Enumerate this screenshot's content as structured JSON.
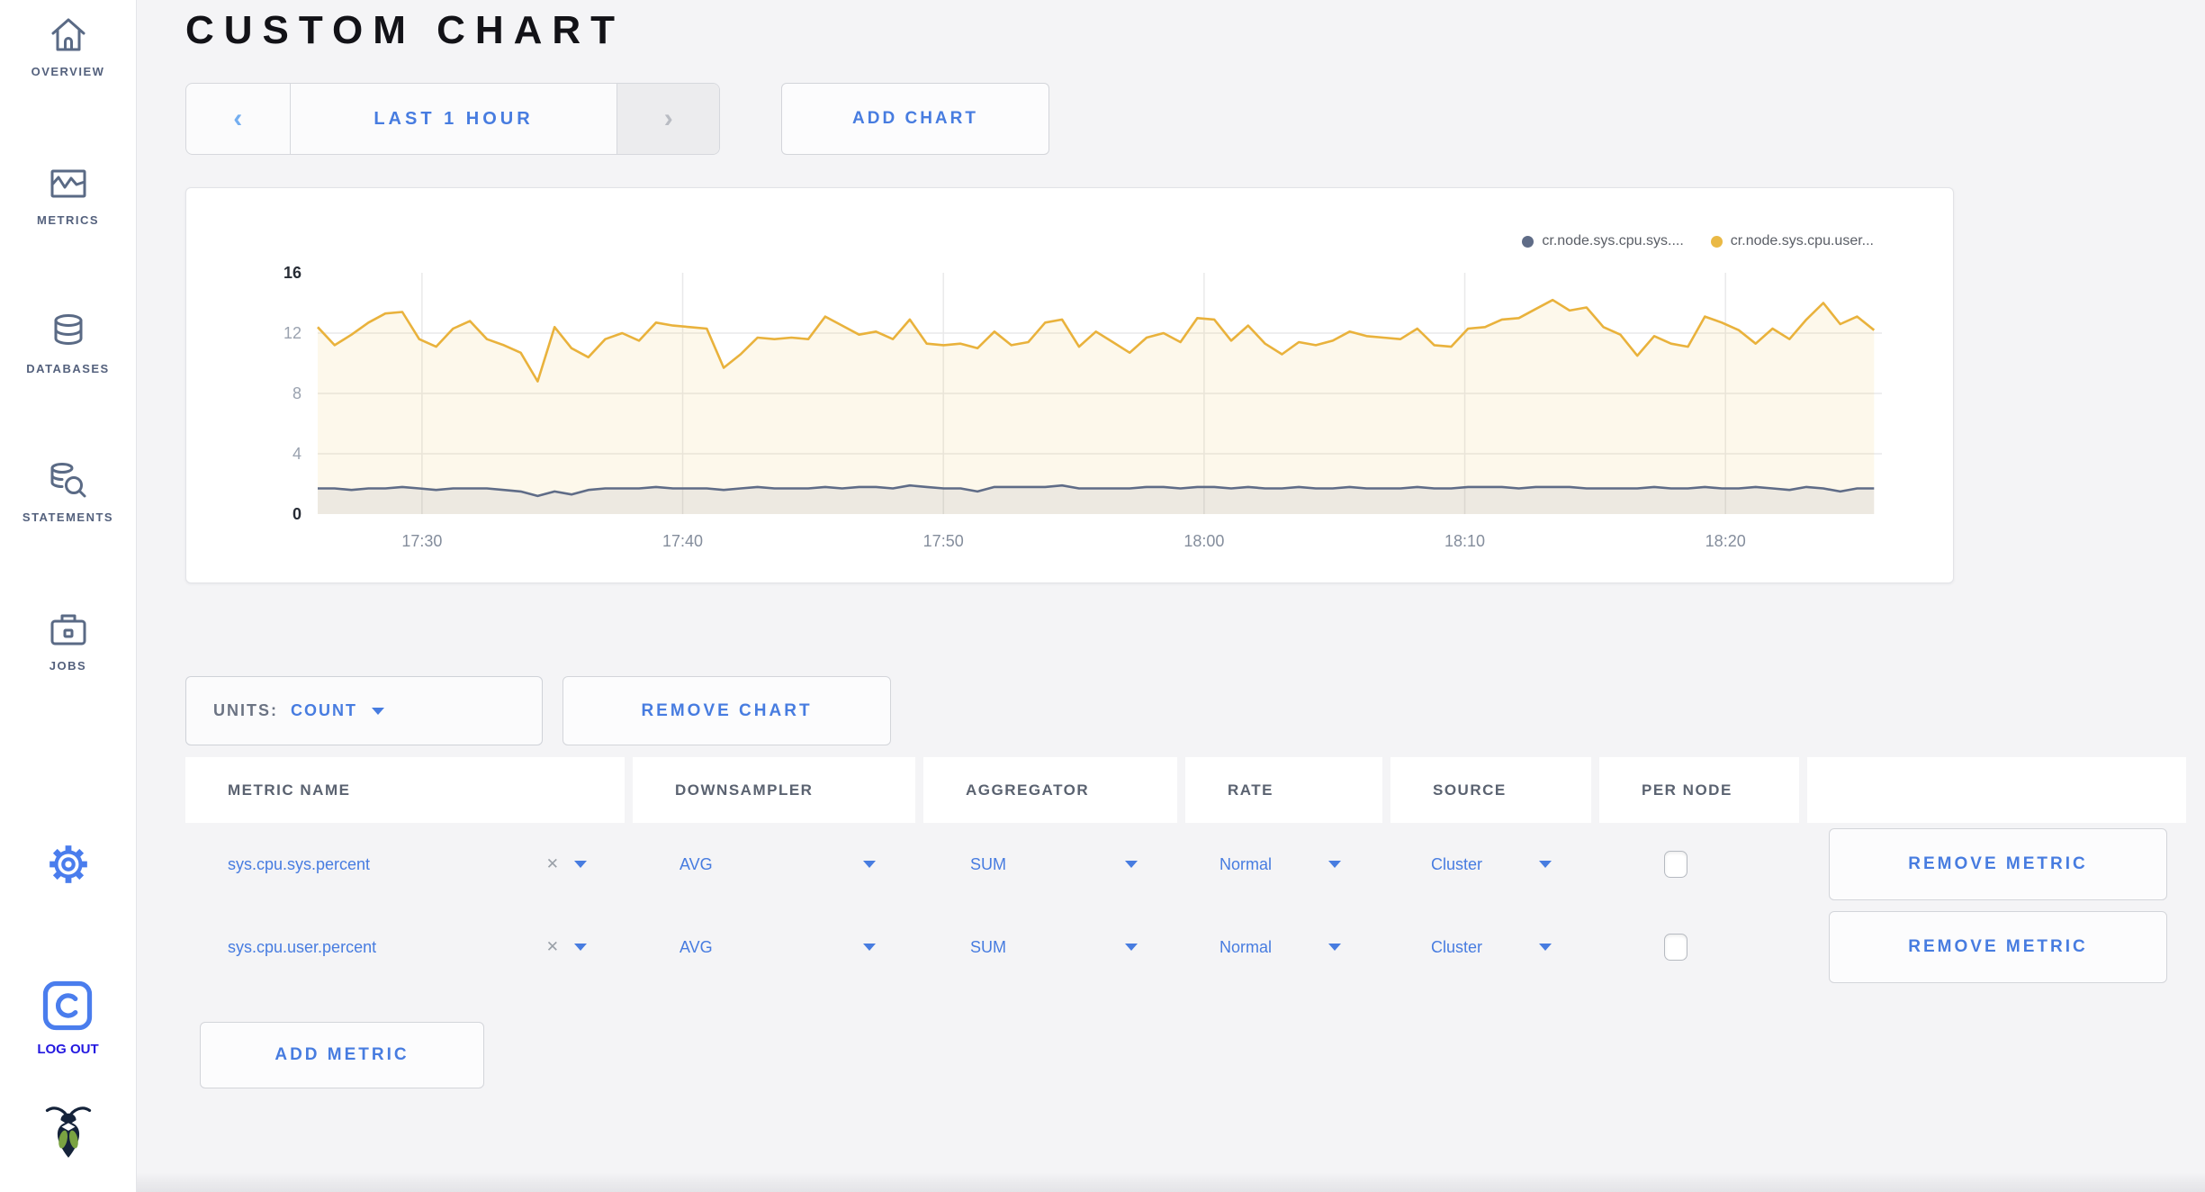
{
  "page": {
    "title": "CUSTOM CHART"
  },
  "sidebar": {
    "items": [
      {
        "label": "OVERVIEW"
      },
      {
        "label": "METRICS"
      },
      {
        "label": "DATABASES"
      },
      {
        "label": "STATEMENTS"
      },
      {
        "label": "JOBS"
      }
    ],
    "logout_label": "LOG OUT"
  },
  "toolbar": {
    "prev_arrow": "‹",
    "time_range_label": "LAST 1 HOUR",
    "next_arrow": "›",
    "add_chart_label": "ADD CHART"
  },
  "chart_controls": {
    "units_label": "UNITS:",
    "units_value": "COUNT",
    "remove_chart_label": "REMOVE CHART",
    "add_metric_label": "ADD METRIC"
  },
  "legend": [
    {
      "label": "cr.node.sys.cpu.sys....",
      "color": "#5f6c87"
    },
    {
      "label": "cr.node.sys.cpu.user...",
      "color": "#eab945"
    }
  ],
  "table": {
    "headers": [
      "METRIC NAME",
      "DOWNSAMPLER",
      "AGGREGATOR",
      "RATE",
      "SOURCE",
      "PER NODE",
      ""
    ],
    "rows": [
      {
        "metric": "sys.cpu.sys.percent",
        "downsampler": "AVG",
        "aggregator": "SUM",
        "rate": "Normal",
        "source": "Cluster",
        "per_node_checked": false,
        "remove_label": "REMOVE METRIC"
      },
      {
        "metric": "sys.cpu.user.percent",
        "downsampler": "AVG",
        "aggregator": "SUM",
        "rate": "Normal",
        "source": "Cluster",
        "per_node_checked": false,
        "remove_label": "REMOVE METRIC"
      }
    ]
  },
  "chart_data": {
    "type": "line",
    "title": "",
    "xlabel": "",
    "ylabel": "",
    "ylim": [
      0,
      16
    ],
    "y_ticks": [
      0,
      4,
      8,
      12,
      16
    ],
    "x_start": "17:26",
    "x_end": "18:26",
    "x_tick_labels": [
      "17:30",
      "17:40",
      "17:50",
      "18:00",
      "18:10",
      "18:20"
    ],
    "x_tick_interval_minutes": 10,
    "grid": true,
    "legend_position": "top-right",
    "series": [
      {
        "name": "cr.node.sys.cpu.sys....",
        "color": "#5f6c87",
        "fill": "rgba(95,108,135,0.10)",
        "values": [
          1.7,
          1.7,
          1.6,
          1.7,
          1.7,
          1.8,
          1.7,
          1.6,
          1.7,
          1.7,
          1.7,
          1.6,
          1.5,
          1.2,
          1.5,
          1.3,
          1.6,
          1.7,
          1.7,
          1.7,
          1.8,
          1.7,
          1.7,
          1.7,
          1.6,
          1.7,
          1.8,
          1.7,
          1.7,
          1.7,
          1.8,
          1.7,
          1.8,
          1.8,
          1.7,
          1.9,
          1.8,
          1.7,
          1.7,
          1.5,
          1.8,
          1.8,
          1.8,
          1.8,
          1.9,
          1.7,
          1.7,
          1.7,
          1.7,
          1.8,
          1.8,
          1.7,
          1.8,
          1.8,
          1.7,
          1.8,
          1.7,
          1.7,
          1.8,
          1.7,
          1.7,
          1.8,
          1.7,
          1.7,
          1.7,
          1.8,
          1.7,
          1.7,
          1.8,
          1.8,
          1.8,
          1.7,
          1.8,
          1.8,
          1.8,
          1.7,
          1.7,
          1.7,
          1.7,
          1.8,
          1.7,
          1.7,
          1.8,
          1.7,
          1.7,
          1.8,
          1.7,
          1.6,
          1.8,
          1.7,
          1.5,
          1.7,
          1.7
        ]
      },
      {
        "name": "cr.node.sys.cpu.user...",
        "color": "#e9b23c",
        "fill": "rgba(233,184,57,0.10)",
        "values": [
          12.4,
          11.2,
          11.9,
          12.7,
          13.3,
          13.4,
          11.6,
          11.1,
          12.3,
          12.8,
          11.6,
          11.2,
          10.7,
          8.8,
          12.4,
          11.0,
          10.4,
          11.6,
          12.0,
          11.5,
          12.7,
          12.5,
          12.4,
          12.3,
          9.7,
          10.6,
          11.7,
          11.6,
          11.7,
          11.6,
          13.1,
          12.5,
          11.9,
          12.1,
          11.6,
          12.9,
          11.3,
          11.2,
          11.3,
          11.0,
          12.1,
          11.2,
          11.4,
          12.7,
          12.9,
          11.1,
          12.1,
          11.4,
          10.7,
          11.7,
          12.0,
          11.4,
          13.0,
          12.9,
          11.5,
          12.5,
          11.3,
          10.6,
          11.4,
          11.2,
          11.5,
          12.1,
          11.8,
          11.7,
          11.6,
          12.3,
          11.2,
          11.1,
          12.3,
          12.4,
          12.9,
          13.0,
          13.6,
          14.2,
          13.5,
          13.7,
          12.4,
          11.9,
          10.5,
          11.8,
          11.3,
          11.1,
          13.1,
          12.7,
          12.2,
          11.3,
          12.3,
          11.6,
          12.9,
          14.0,
          12.6,
          13.1,
          12.2
        ]
      }
    ]
  },
  "colors": {
    "accent_blue": "#477ce0",
    "logout_blue": "#2318e0",
    "icon_slate": "#5a6a85",
    "grid_gray": "#e9e9ea",
    "series_gray": "#5f6c87",
    "series_yellow": "#e9b23c"
  }
}
